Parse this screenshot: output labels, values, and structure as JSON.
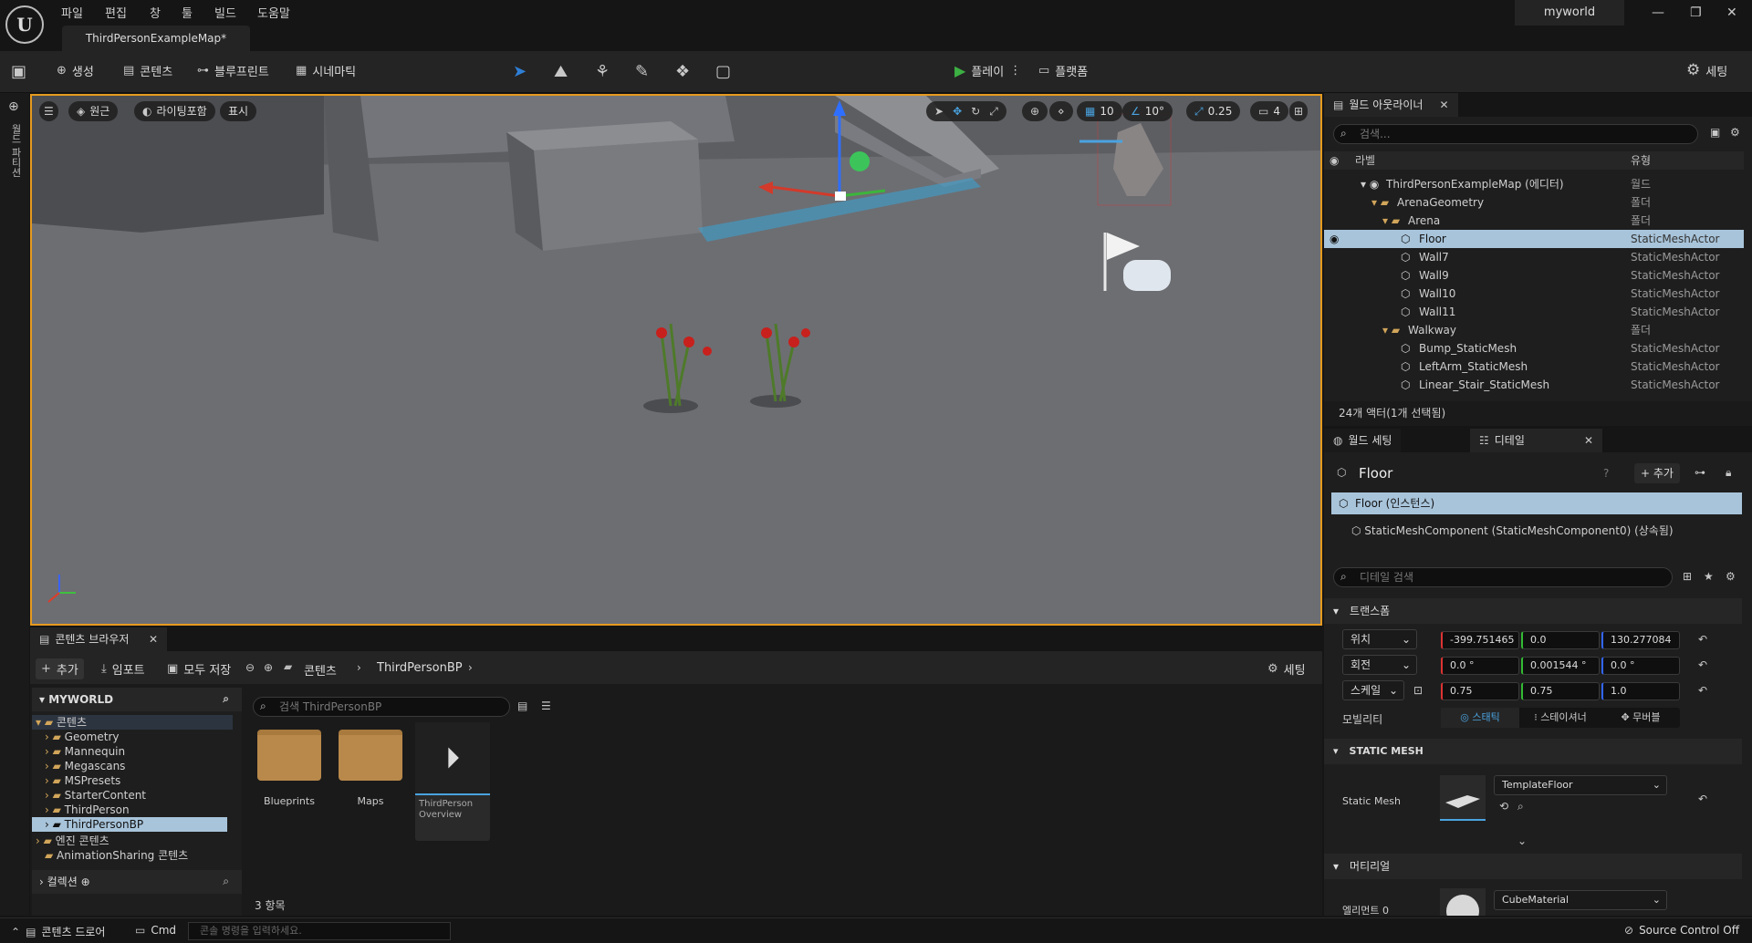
{
  "menu": [
    "파일",
    "편집",
    "창",
    "툴",
    "빌드",
    "도움말"
  ],
  "map_tab": "ThirdPersonExampleMap*",
  "project_name": "myworld",
  "toolbar": {
    "create": "생성",
    "content": "콘텐츠",
    "blueprint": "블루프린트",
    "cinematic": "시네마틱",
    "play": "플레이",
    "platform": "플랫폼",
    "settings": "세팅"
  },
  "viewport": {
    "perspective": "원근",
    "lighting": "라이팅포함",
    "show": "표시",
    "grid_snap": "10",
    "rot_snap": "10°",
    "scale_snap": "0.25",
    "camera_speed": "4",
    "side_label": "월드 파티션"
  },
  "outliner": {
    "tab": "월드 아웃라이너",
    "search_placeholder": "검색...",
    "col_label": "라벨",
    "col_type": "유형",
    "rows": [
      {
        "label": "ThirdPersonExampleMap (에디터)",
        "type": "월드"
      },
      {
        "label": "ArenaGeometry",
        "type": "폴더"
      },
      {
        "label": "Arena",
        "type": "폴더"
      },
      {
        "label": "Floor",
        "type": "StaticMeshActor"
      },
      {
        "label": "Wall7",
        "type": "StaticMeshActor"
      },
      {
        "label": "Wall9",
        "type": "StaticMeshActor"
      },
      {
        "label": "Wall10",
        "type": "StaticMeshActor"
      },
      {
        "label": "Wall11",
        "type": "StaticMeshActor"
      },
      {
        "label": "Walkway",
        "type": "폴더"
      },
      {
        "label": "Bump_StaticMesh",
        "type": "StaticMeshActor"
      },
      {
        "label": "LeftArm_StaticMesh",
        "type": "StaticMeshActor"
      },
      {
        "label": "Linear_Stair_StaticMesh",
        "type": "StaticMeshActor"
      }
    ],
    "footer": "24개 액터(1개 선택됨)"
  },
  "details": {
    "tab_world": "월드 세팅",
    "tab_details": "디테일",
    "actor": "Floor",
    "add": "추가",
    "instance": "Floor (인스턴스)",
    "component": "StaticMeshComponent (StaticMeshComponent0) (상속됨)",
    "search_placeholder": "디테일 검색",
    "transform": "트랜스폼",
    "location_label": "위치",
    "rotation_label": "회전",
    "scale_label": "스케일",
    "location": [
      "-399.751465",
      "0.0",
      "130.277084"
    ],
    "rotation": [
      "0.0 °",
      "0.001544 °",
      "0.0 °"
    ],
    "scale": [
      "0.75",
      "0.75",
      "1.0"
    ],
    "mobility": "모빌리티",
    "mobility_options": [
      "스태틱",
      "스테이셔너",
      "무버블"
    ],
    "static_mesh_section": "STATIC MESH",
    "static_mesh_label": "Static Mesh",
    "static_mesh_value": "TemplateFloor",
    "material_section": "머티리얼",
    "element0": "엘리먼트 0",
    "material_value": "CubeMaterial"
  },
  "content_browser": {
    "tab": "콘텐츠 브라우저",
    "add": "추가",
    "import": "임포트",
    "save_all": "모두 저장",
    "path": [
      "콘텐츠",
      "ThirdPersonBP"
    ],
    "settings": "세팅",
    "root": "MYWORLD",
    "content": "콘텐츠",
    "folders": [
      "Geometry",
      "Mannequin",
      "Megascans",
      "MSPresets",
      "StarterContent",
      "ThirdPerson",
      "ThirdPersonBP"
    ],
    "engine_content": "엔진 콘텐츠",
    "animation_sharing": "AnimationSharing 콘텐츠",
    "collections": "컬렉션",
    "search_placeholder": "검색 ThirdPersonBP",
    "assets": [
      "Blueprints",
      "Maps",
      "ThirdPerson Overview"
    ],
    "item_count": "3 항목"
  },
  "statusbar": {
    "drawer": "콘텐츠 드로어",
    "cmd": "Cmd",
    "console_placeholder": "콘솔 명령을 입력하세요.",
    "source_control": "Source Control Off"
  }
}
